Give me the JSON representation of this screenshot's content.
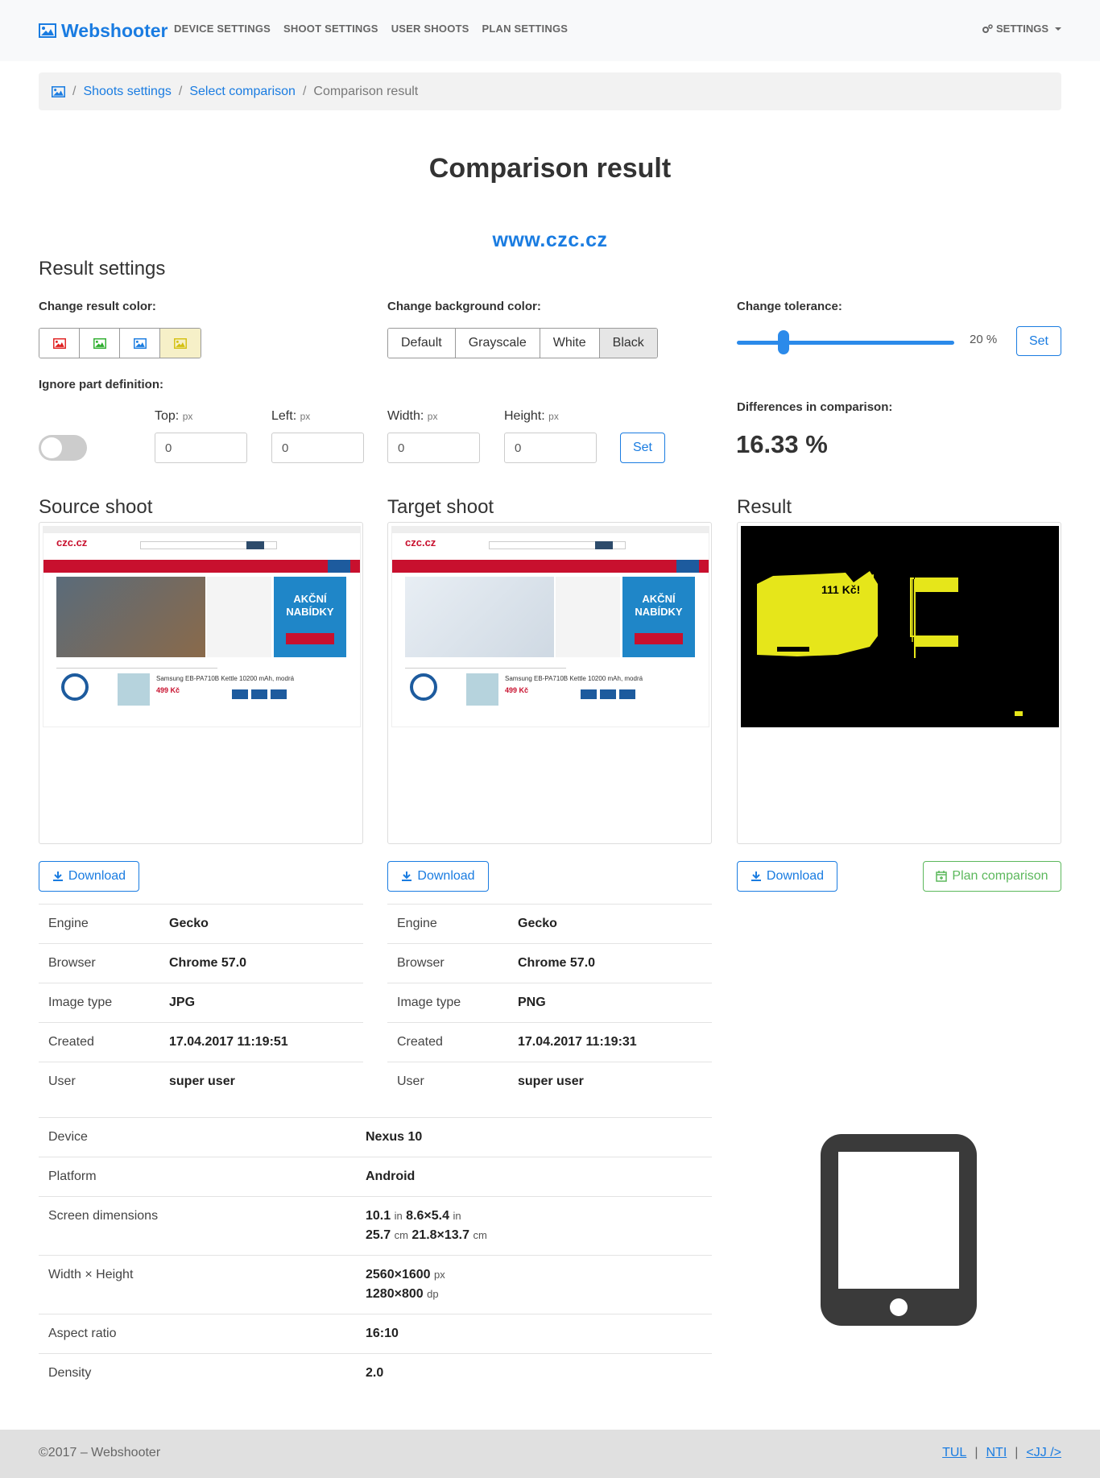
{
  "navbar": {
    "brand": "Webshooter",
    "links": [
      "DEVICE SETTINGS",
      "SHOOT SETTINGS",
      "USER SHOOTS",
      "PLAN SETTINGS"
    ],
    "settings": "SETTINGS"
  },
  "breadcrumb": {
    "items": [
      "Shoots settings",
      "Select comparison"
    ],
    "active": "Comparison result"
  },
  "page": {
    "title": "Comparison result",
    "url": "www.czc.cz"
  },
  "settings": {
    "heading": "Result settings",
    "result_color_label": "Change result color:",
    "result_colors": [
      {
        "name": "red",
        "color": "#e02020"
      },
      {
        "name": "green",
        "color": "#2eae2e"
      },
      {
        "name": "blue",
        "color": "#1a7ce1"
      },
      {
        "name": "yellow",
        "color": "#e6d21a",
        "active": true
      }
    ],
    "bg_color_label": "Change background color:",
    "bg_options": [
      "Default",
      "Grayscale",
      "White",
      "Black"
    ],
    "bg_active": "Black",
    "tolerance_label": "Change tolerance:",
    "tolerance_value": "20 %",
    "tolerance_fraction": 0.2,
    "set_label": "Set",
    "ignore_label": "Ignore part definition:",
    "ignore_enabled": false,
    "fields": [
      {
        "label": "Top:",
        "unit": "px",
        "value": "0"
      },
      {
        "label": "Left:",
        "unit": "px",
        "value": "0"
      },
      {
        "label": "Width:",
        "unit": "px",
        "value": "0"
      },
      {
        "label": "Height:",
        "unit": "px",
        "value": "0"
      }
    ],
    "set2_label": "Set",
    "diff_label": "Differences in comparison:",
    "diff_value": "16.33 %"
  },
  "source": {
    "heading": "Source shoot",
    "download": "Download",
    "rows": [
      {
        "k": "Engine",
        "v": "Gecko"
      },
      {
        "k": "Browser",
        "v": "Chrome 57.0"
      },
      {
        "k": "Image type",
        "v": "JPG"
      },
      {
        "k": "Created",
        "v": "17.04.2017 11:19:51"
      },
      {
        "k": "User",
        "v": "super user"
      }
    ],
    "shot": {
      "logo": "czc.cz",
      "promo1": "AKČNÍ",
      "promo2": "NABÍDKY",
      "product": "Samsung EB-PA710B Kettle 10200 mAh, modrá",
      "price": "499 Kč"
    }
  },
  "target": {
    "heading": "Target shoot",
    "download": "Download",
    "rows": [
      {
        "k": "Engine",
        "v": "Gecko"
      },
      {
        "k": "Browser",
        "v": "Chrome 57.0"
      },
      {
        "k": "Image type",
        "v": "PNG"
      },
      {
        "k": "Created",
        "v": "17.04.2017 11:19:31"
      },
      {
        "k": "User",
        "v": "super user"
      }
    ],
    "shot": {
      "logo": "czc.cz",
      "promo1": "AKČNÍ",
      "promo2": "NABÍDKY",
      "product": "Samsung EB-PA710B Kettle 10200 mAh, modrá",
      "price": "499 Kč"
    }
  },
  "result": {
    "heading": "Result",
    "download": "Download",
    "plan": "Plan comparison",
    "text": "111 Kč!"
  },
  "device": {
    "rows": [
      {
        "k": "Device",
        "v": "Nexus 10"
      },
      {
        "k": "Platform",
        "v": "Android"
      },
      {
        "k": "Screen dimensions",
        "v1": "10.1",
        "u1": "in",
        "v2": "8.6×5.4",
        "u2": "in",
        "v3": "25.7",
        "u3": "cm",
        "v4": "21.8×13.7",
        "u4": "cm"
      },
      {
        "k": "Width × Height",
        "v1": "2560×1600",
        "u1": "px",
        "v2": "1280×800",
        "u2": "dp"
      },
      {
        "k": "Aspect ratio",
        "v": "16:10"
      },
      {
        "k": "Density",
        "v": "2.0"
      }
    ]
  },
  "footer": {
    "copy": "©2017 – Webshooter",
    "links": [
      "TUL",
      "NTI",
      "<JJ />"
    ]
  }
}
